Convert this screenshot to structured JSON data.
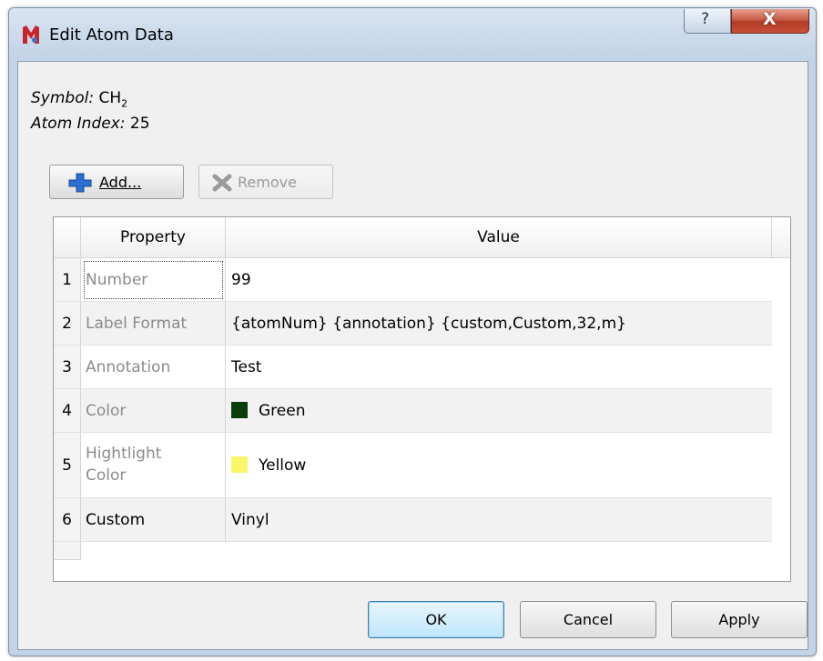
{
  "window": {
    "title": "Edit Atom Data"
  },
  "info": {
    "symbol_label": "Symbol:",
    "symbol_main": "CH",
    "symbol_sub": "2",
    "index_label": "Atom Index:",
    "index_value": "25"
  },
  "toolbar": {
    "add_label": "Add...",
    "remove_label": "Remove"
  },
  "table": {
    "headers": {
      "property": "Property",
      "value": "Value"
    },
    "rows": [
      {
        "num": "1",
        "property": "Number",
        "value": "99"
      },
      {
        "num": "2",
        "property": "Label Format",
        "value": "{atomNum} {annotation} {custom,Custom,32,m}"
      },
      {
        "num": "3",
        "property": "Annotation",
        "value": "Test"
      },
      {
        "num": "4",
        "property": "Color",
        "value": "Green",
        "swatch": "#0b3d0b"
      },
      {
        "num": "5",
        "property_line1": "Hightlight",
        "property_line2": "Color",
        "value": "Yellow",
        "swatch": "#fbf56a"
      },
      {
        "num": "6",
        "property": "Custom",
        "value": "Vinyl"
      }
    ]
  },
  "buttons": {
    "ok": "OK",
    "cancel": "Cancel",
    "apply": "Apply"
  },
  "titlebar_buttons": {
    "help": "?",
    "close": "X"
  }
}
